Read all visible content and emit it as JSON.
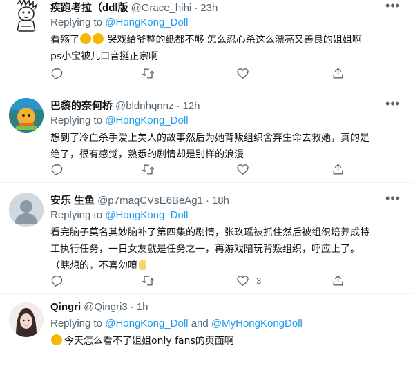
{
  "tweets": [
    {
      "name": "疾跑考拉（ddl版",
      "handle": "@Grace_hihi",
      "dot": "·",
      "time": "23h",
      "replying_label": "Replying to ",
      "mentions": [
        "@HongKong_Doll"
      ],
      "line1_pre": "看殇了",
      "line1_post": " 哭戏给爷整的纸都不够 怎么忍心杀这么漂亮又善良的姐姐啊",
      "line2": "ps小宝被儿口音挺正宗啊",
      "reply_count": "",
      "retweet_count": "",
      "like_count": ""
    },
    {
      "name": "巴黎的奈何桥",
      "handle": "@bldnhqnnz",
      "dot": "·",
      "time": "12h",
      "replying_label": "Replying to ",
      "mentions": [
        "@HongKong_Doll"
      ],
      "line1": "想到了冷血杀手爱上美人的故事然后为她背叛组织舍弃生命去救她，真的是",
      "line2": "绝了，很有感觉，熟悉的剧情却是别样的浪漫",
      "reply_count": "",
      "retweet_count": "",
      "like_count": ""
    },
    {
      "name": "安乐 生鱼",
      "handle": "@p7maqCVsE6BeAg1",
      "dot": "·",
      "time": "18h",
      "replying_label": "Replying to ",
      "mentions": [
        "@HongKong_Doll"
      ],
      "line1": "看完脑子莫名其妙脑补了第四集的剧情，张玖瑶被抓住然后被组织培养成特",
      "line2": "工执行任务，一日女友就是任务之一，再游戏陪玩背叛组织，呼应上了。",
      "line3": "（瞎想的，不喜勿喷",
      "reply_count": "",
      "retweet_count": "",
      "like_count": "3"
    },
    {
      "name": "Qingri",
      "handle": "@Qingri3",
      "dot": "·",
      "time": "1h",
      "replying_label": "Replying to ",
      "mentions": [
        "@HongKong_Doll",
        "@MyHongKongDoll"
      ],
      "and_label": " and ",
      "line1": "今天怎么看不了姐姐only fans的页面啊"
    }
  ],
  "icons": {
    "reply": "reply-icon",
    "retweet": "retweet-icon",
    "like": "heart-icon",
    "share": "share-icon",
    "more": "more-icon"
  },
  "colors": {
    "link": "#1d9bf0",
    "muted": "#536471",
    "divider": "#eff3f4"
  }
}
